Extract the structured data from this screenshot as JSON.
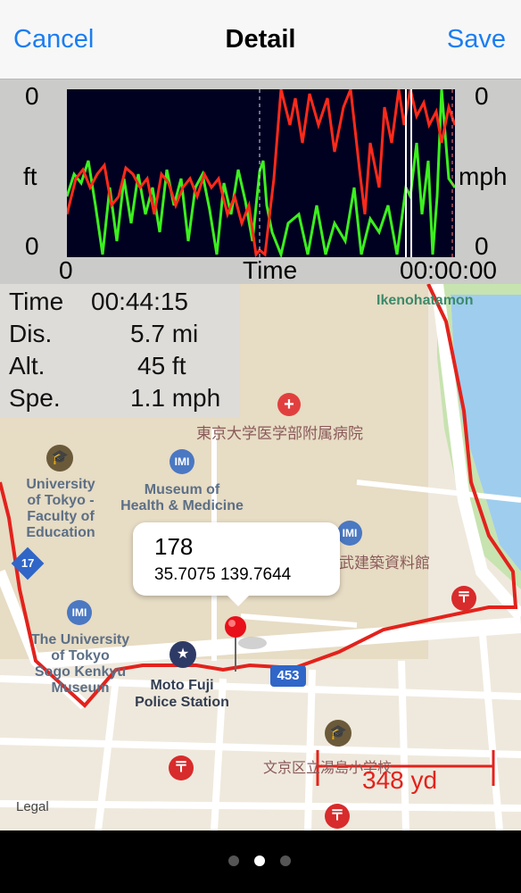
{
  "nav": {
    "cancel": "Cancel",
    "title": "Detail",
    "save": "Save"
  },
  "chart": {
    "left_top": "0",
    "left_unit": "ft",
    "left_bottom": "0",
    "right_top": "0",
    "right_unit": "mph",
    "right_bottom": "0",
    "x_start": "0",
    "x_label": "Time",
    "x_end": "00:00:00"
  },
  "stats": {
    "time_label": "Time",
    "time_value": "00:44:15",
    "dist_label": "Dis.",
    "dist_value": "5.7 mi",
    "alt_label": "Alt.",
    "alt_value": "45 ft",
    "speed_label": "Spe.",
    "speed_value": "1.1 mph"
  },
  "map": {
    "places": {
      "ikenohatamon": "Ikenohatamon",
      "hospital": "東京大学医学部附属病院",
      "univ_education_1": "University",
      "univ_education_2": "of Tokyo -",
      "univ_education_3": "Faculty of",
      "univ_education_4": "Education",
      "museum_1": "Museum of",
      "museum_2": "Health & Medicine",
      "archives": "武建築資料館",
      "univ_sogo_1": "The University",
      "univ_sogo_2": "of Tokyo",
      "univ_sogo_3": "Sogo Kenkyu",
      "univ_sogo_4": "Museum",
      "police_1": "Moto Fuji",
      "police_2": "Police Station",
      "school": "文京区立湯島小学校",
      "route_number": "453",
      "route_left": "17"
    },
    "callout": {
      "title": "178",
      "coords": "35.7075 139.7644"
    },
    "scale": "348 yd",
    "legal": "Legal"
  },
  "pager": {
    "current": 2,
    "total": 3
  },
  "colors": {
    "accent": "#1a7df2",
    "track": "#e3221c",
    "speed_line": "#ff2a1a",
    "alt_line": "#3cf01e"
  }
}
